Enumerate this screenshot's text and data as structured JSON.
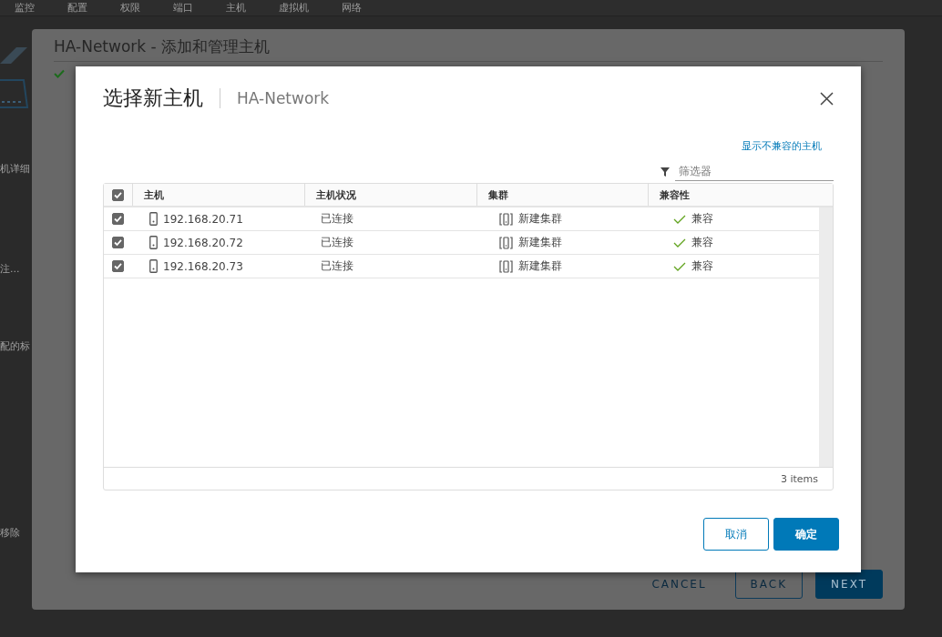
{
  "background": {
    "nav_tabs": [
      "监控",
      "配置",
      "权限",
      "端口",
      "主机",
      "虚拟机",
      "网络"
    ],
    "side_fragments": [
      "机详细",
      "注...",
      "配的标",
      "移除"
    ]
  },
  "wizard": {
    "title": "HA-Network - 添加和管理主机",
    "buttons": [
      {
        "label": "CANCEL",
        "kind": "flat"
      },
      {
        "label": "BACK",
        "kind": "outline"
      },
      {
        "label": "NEXT",
        "kind": "primary"
      }
    ]
  },
  "dialog": {
    "title": "选择新主机",
    "subtitle": "HA-Network",
    "link": "显示不兼容的主机",
    "filter": {
      "placeholder": "筛选器"
    },
    "table": {
      "select_all": true,
      "columns": [
        "主机",
        "主机状况",
        "集群",
        "兼容性"
      ],
      "rows": [
        {
          "checked": true,
          "host": "192.168.20.71",
          "status": "已连接",
          "cluster": "新建集群",
          "compatibility": "兼容"
        },
        {
          "checked": true,
          "host": "192.168.20.72",
          "status": "已连接",
          "cluster": "新建集群",
          "compatibility": "兼容"
        },
        {
          "checked": true,
          "host": "192.168.20.73",
          "status": "已连接",
          "cluster": "新建集群",
          "compatibility": "兼容"
        }
      ],
      "footer": "3 items"
    },
    "buttons": [
      {
        "label": "取消",
        "kind": "outline"
      },
      {
        "label": "确定",
        "kind": "primary"
      }
    ]
  }
}
